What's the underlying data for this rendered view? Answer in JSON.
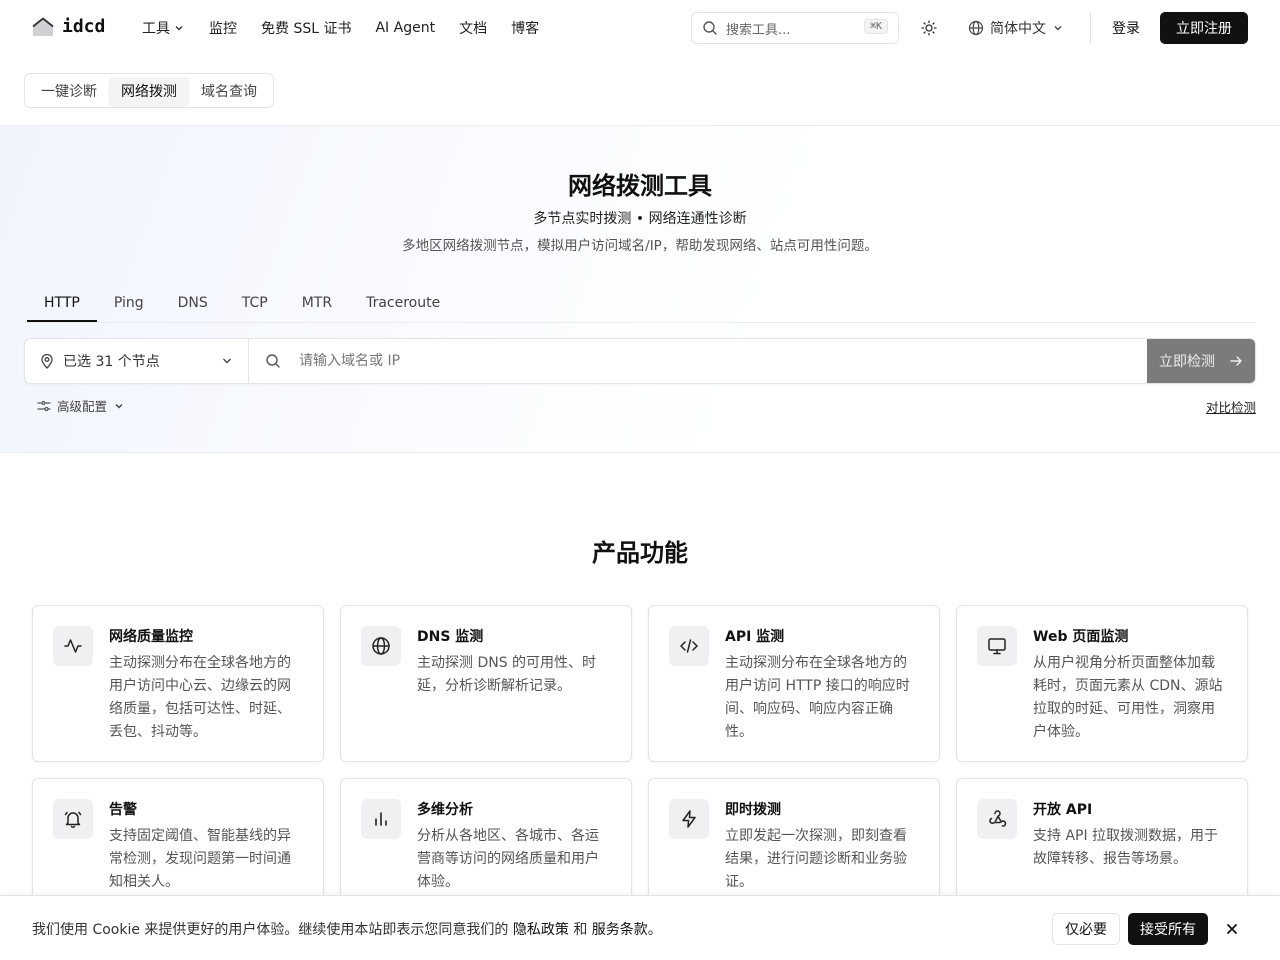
{
  "brand": {
    "name": "idcd"
  },
  "nav": {
    "items": [
      {
        "label": "工具",
        "has_dropdown": true
      },
      {
        "label": "监控"
      },
      {
        "label": "免费 SSL 证书"
      },
      {
        "label": "AI Agent"
      },
      {
        "label": "文档"
      },
      {
        "label": "博客"
      }
    ],
    "search_placeholder": "搜索工具...",
    "search_shortcut": "⌘K",
    "language": "简体中文",
    "login": "登录",
    "signup": "立即注册"
  },
  "subtabs": [
    {
      "label": "一键诊断",
      "active": false
    },
    {
      "label": "网络拨测",
      "active": true
    },
    {
      "label": "域名查询",
      "active": false
    }
  ],
  "hero": {
    "title": "网络拨测工具",
    "subtitle": "多节点实时拨测 • 网络连通性诊断",
    "description": "多地区网络拨测节点，模拟用户访问域名/IP，帮助发现网络、站点可用性问题。"
  },
  "probe_tabs": [
    {
      "label": "HTTP",
      "active": true
    },
    {
      "label": "Ping",
      "active": false
    },
    {
      "label": "DNS",
      "active": false
    },
    {
      "label": "TCP",
      "active": false
    },
    {
      "label": "MTR",
      "active": false
    },
    {
      "label": "Traceroute",
      "active": false
    }
  ],
  "probe": {
    "nodes_selected": "已选 31 个节点",
    "input_placeholder": "请输入域名或 IP",
    "check_button": "立即检测",
    "advanced": "高级配置",
    "compare": "对比检测"
  },
  "features": {
    "title": "产品功能",
    "cards": [
      {
        "icon": "activity-icon",
        "title": "网络质量监控",
        "desc": "主动探测分布在全球各地方的用户访问中心云、边缘云的网络质量，包括可达性、时延、丢包、抖动等。"
      },
      {
        "icon": "globe-icon",
        "title": "DNS 监测",
        "desc": "主动探测 DNS 的可用性、时延，分析诊断解析记录。"
      },
      {
        "icon": "code-icon",
        "title": "API 监测",
        "desc": "主动探测分布在全球各地方的用户访问 HTTP 接口的响应时间、响应码、响应内容正确性。"
      },
      {
        "icon": "monitor-icon",
        "title": "Web 页面监测",
        "desc": "从用户视角分析页面整体加载耗时，页面元素从 CDN、源站拉取的时延、可用性，洞察用户体验。"
      },
      {
        "icon": "bell-icon",
        "title": "告警",
        "desc": "支持固定阈值、智能基线的异常检测，发现问题第一时间通知相关人。"
      },
      {
        "icon": "bar-chart-icon",
        "title": "多维分析",
        "desc": "分析从各地区、各城市、各运营商等访问的网络质量和用户体验。"
      },
      {
        "icon": "zap-icon",
        "title": "即时拨测",
        "desc": "立即发起一次探测，即刻查看结果，进行问题诊断和业务验证。"
      },
      {
        "icon": "webhook-icon",
        "title": "开放 API",
        "desc": "支持 API 拉取拨测数据，用于故障转移、报告等场景。"
      }
    ]
  },
  "cookie": {
    "text_before": "我们使用 Cookie 来提供更好的用户体验。继续使用本站即表示您同意我们的 ",
    "privacy": "隐私政策",
    "and": " 和 ",
    "terms": "服务条款",
    "period": "。",
    "necessary_only": "仅必要",
    "accept_all": "接受所有"
  }
}
